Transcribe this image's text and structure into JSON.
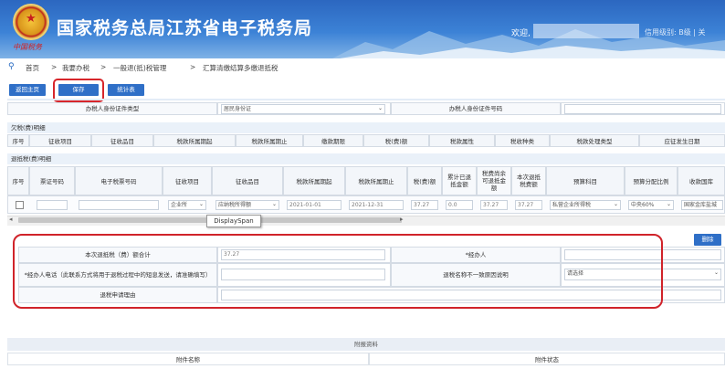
{
  "header": {
    "title": "国家税务总局江苏省电子税务局",
    "signature": "中国税务",
    "welcome": "欢迎,",
    "credit": "信用级别: B级 | 关"
  },
  "breadcrumb": {
    "items": [
      "首页",
      ">",
      "我要办税",
      ">",
      "一般退(抵)税管理",
      ">",
      "汇算清缴结算多缴退抵税"
    ]
  },
  "toolbar": {
    "back_label": "返回主页",
    "save_label": "保存",
    "stats_label": "统计表"
  },
  "taxpayer_row": {
    "id_type_label": "办税人身份证件类型",
    "id_type_value": "居民身份证",
    "id_no_label": "办税人身份证件号码",
    "id_no_value": ""
  },
  "arrears": {
    "title": "欠税(费)明细",
    "columns": [
      "序号",
      "征收项目",
      "征收品目",
      "税款所属期起",
      "税款所属期止",
      "缴款期限",
      "税(费)额",
      "税款属性",
      "税收种类",
      "税款处理类型",
      "应征发生日期"
    ]
  },
  "refund": {
    "title": "退抵税(费)明细",
    "columns": [
      "序号",
      "票证号码",
      "电子税票号码",
      "征收项目",
      "征收品目",
      "税款所属期起",
      "税款所属期止",
      "税(费)额",
      "累计已退抵金额",
      "税费尚余可退抵金额",
      "本次退抵税费额",
      "预算科目",
      "预算分配比例",
      "收款国库"
    ],
    "row": {
      "ticket_no": "",
      "e_ticket_no": "",
      "levy_item": "企业所",
      "levy_subitem": "应纳税所得额",
      "period_start": "2021-01-01",
      "period_end": "2021-12-31",
      "tax_amount": "37.27",
      "refunded": "0.0",
      "remaining": "37.27",
      "this_refund": "37.27",
      "budget_subject": "私营企业所得税",
      "ratio": "中央60%",
      "treasury": "国家金库盐城"
    }
  },
  "tooltip": "DisplaySpan",
  "delete_label": "删除",
  "summary": {
    "total_label": "本次退抵税（费）额合计",
    "total_value": "37.27",
    "agent_label": "*经办人",
    "agent_value": "",
    "phone_label": "*经办人电话（此联系方式将用于退税过程中的短息发送，请准确填写）",
    "phone_value": "",
    "mismatch_label": "退税名称不一致原因说明",
    "mismatch_value": "请选择",
    "reason_label": "退税申请理由",
    "reason_value": ""
  },
  "attachments": {
    "title": "附报资料",
    "name_col": "附件名称",
    "status_col": "附件状态"
  },
  "colors": {
    "banner": "#2c67c0",
    "button": "#2f6fc7",
    "highlight": "#d0232a"
  }
}
